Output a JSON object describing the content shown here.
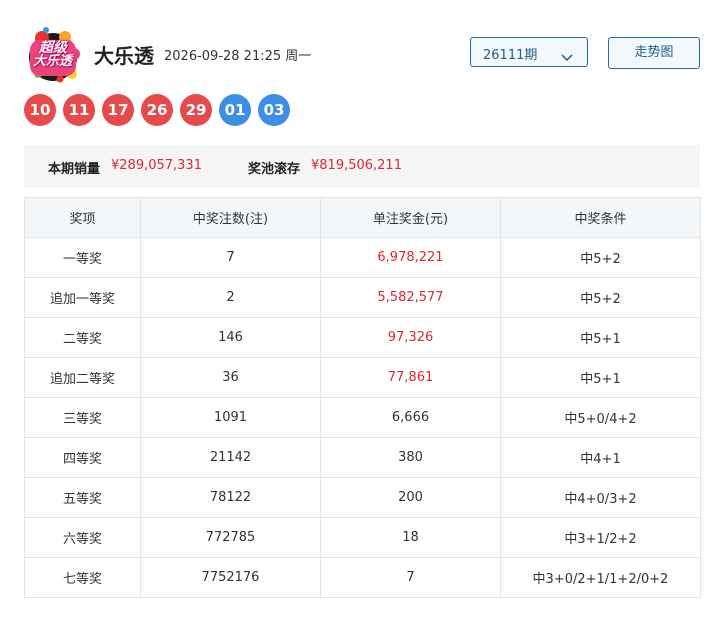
{
  "header": {
    "logo_line1": "超级",
    "logo_line2": "大乐透",
    "title": "大乐透",
    "datetime": "2026-09-28 21:25 周一",
    "period_select": "26111期",
    "trend_button": "走势图"
  },
  "draw": {
    "front_balls": [
      "10",
      "11",
      "17",
      "26",
      "29"
    ],
    "back_balls": [
      "01",
      "03"
    ]
  },
  "summary": {
    "sales_label": "本期销量",
    "sales_value": "¥289,057,331",
    "pool_label": "奖池滚存",
    "pool_value": "¥819,506,211"
  },
  "table": {
    "headers": [
      "奖项",
      "中奖注数(注)",
      "单注奖金(元)",
      "中奖条件"
    ],
    "rows": [
      {
        "prize": "一等奖",
        "count": "7",
        "amount": "6,978,221",
        "cond": "中5+2"
      },
      {
        "prize": "追加一等奖",
        "count": "2",
        "amount": "5,582,577",
        "cond": "中5+2"
      },
      {
        "prize": "二等奖",
        "count": "146",
        "amount": "97,326",
        "cond": "中5+1"
      },
      {
        "prize": "追加二等奖",
        "count": "36",
        "amount": "77,861",
        "cond": "中5+1"
      },
      {
        "prize": "三等奖",
        "count": "1091",
        "amount": "6,666",
        "cond": "中5+0/4+2"
      },
      {
        "prize": "四等奖",
        "count": "21142",
        "amount": "380",
        "cond": "中4+1"
      },
      {
        "prize": "五等奖",
        "count": "78122",
        "amount": "200",
        "cond": "中4+0/3+2"
      },
      {
        "prize": "六等奖",
        "count": "772785",
        "amount": "18",
        "cond": "中3+1/2+2"
      },
      {
        "prize": "七等奖",
        "count": "7752176",
        "amount": "7",
        "cond": "中3+0/2+1/1+2/0+2"
      }
    ]
  },
  "colors": {
    "front_ball": "#e64a4a",
    "back_ball": "#3f8ee6",
    "highlight_amount": "#d9282f",
    "accent_border": "#1f6e9c"
  }
}
